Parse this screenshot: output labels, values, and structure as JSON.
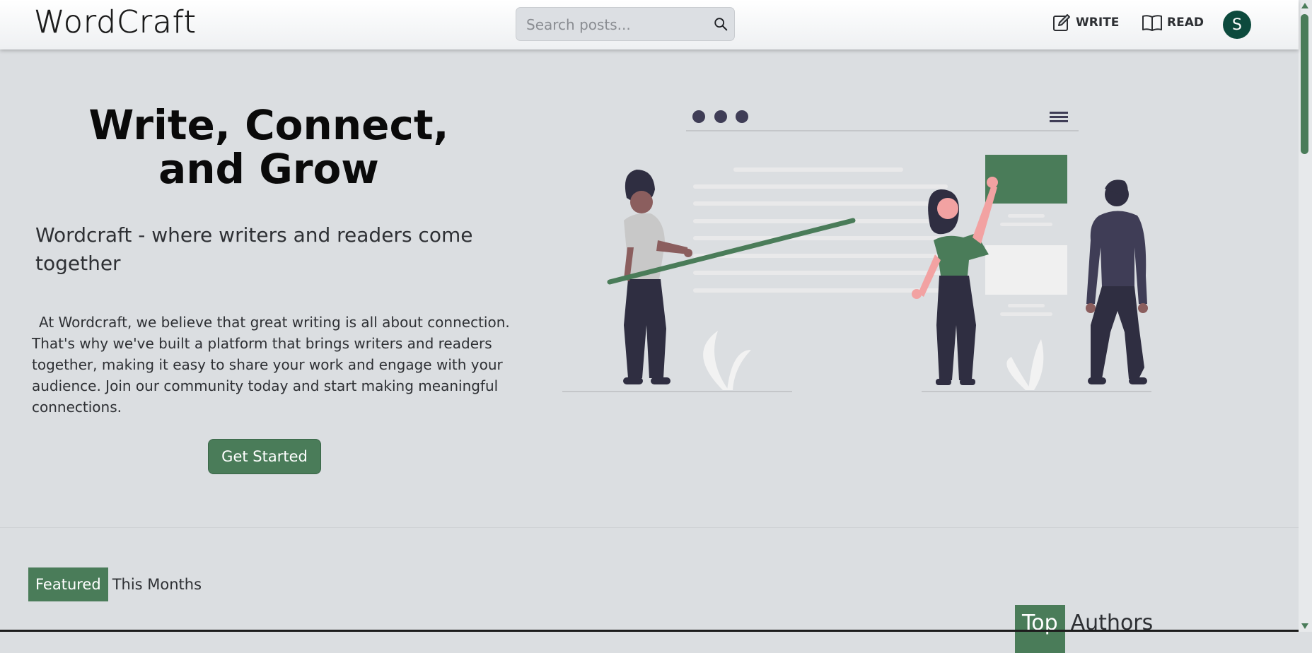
{
  "header": {
    "logo": "WordCraft",
    "search_placeholder": "Search posts...",
    "write_label": "WRITE",
    "read_label": "READ",
    "avatar_initial": "S"
  },
  "hero": {
    "title": "Write, Connect, and Grow",
    "subtitle": "Wordcraft - where writers and readers come together",
    "body": "At Wordcraft, we believe that great writing is all about connection. That's why we've built a platform that brings writers and readers together, making it easy to share your work and engage with your audience. Join our community today and start making meaningful connections.",
    "cta_label": "Get Started"
  },
  "featured": {
    "badge": "Featured",
    "rest": "This Months"
  },
  "top_authors": {
    "badge": "Top",
    "rest": "Authors"
  },
  "colors": {
    "accent": "#4a7c59",
    "avatar": "#0d4a3d",
    "background": "#dbdee1",
    "figure_dark": "#2f2e41"
  }
}
